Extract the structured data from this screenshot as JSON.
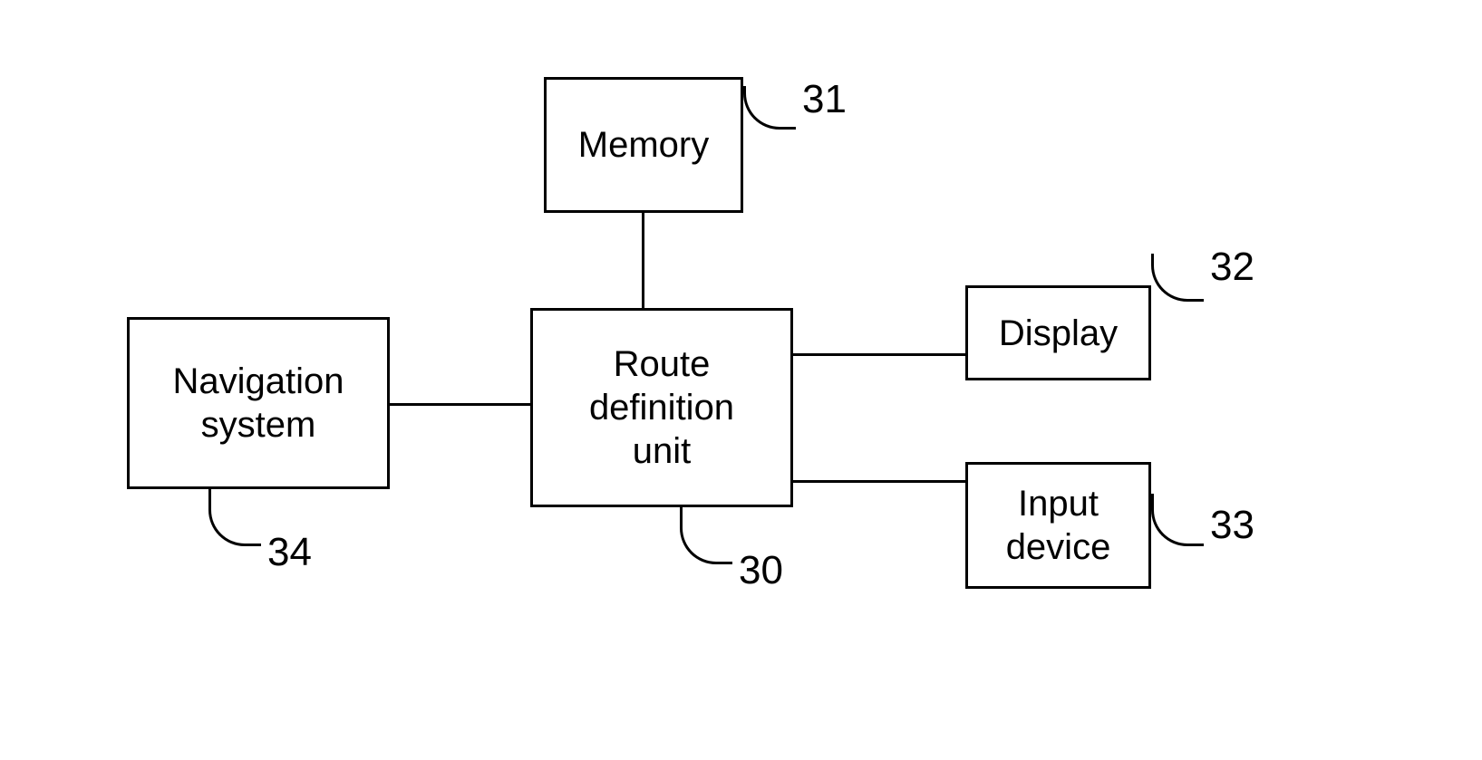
{
  "diagram": {
    "blocks": {
      "memory": {
        "label": "Memory",
        "ref": "31"
      },
      "route_definition_unit": {
        "label": "Route\ndefinition\nunit",
        "ref": "30"
      },
      "navigation_system": {
        "label": "Navigation\nsystem",
        "ref": "34"
      },
      "display": {
        "label": "Display",
        "ref": "32"
      },
      "input_device": {
        "label": "Input\ndevice",
        "ref": "33"
      }
    }
  }
}
